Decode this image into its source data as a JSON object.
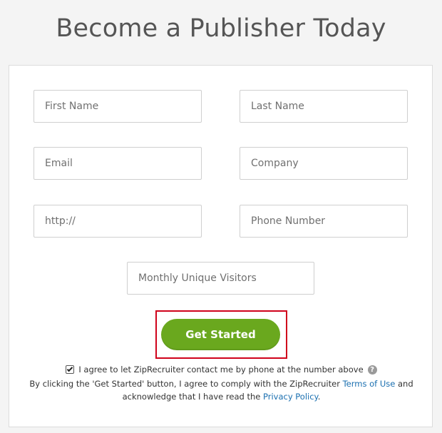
{
  "page": {
    "title": "Become a Publisher Today"
  },
  "form": {
    "first_name_placeholder": "First Name",
    "last_name_placeholder": "Last Name",
    "email_placeholder": "Email",
    "company_placeholder": "Company",
    "url_placeholder": "http://",
    "phone_placeholder": "Phone Number",
    "visitors_placeholder": "Monthly Unique Visitors",
    "submit_label": "Get Started"
  },
  "consent": {
    "checked": true,
    "checkbox_label": "I agree to let ZipRecruiter contact me by phone at the number above",
    "help_icon": "question-circle-icon",
    "terms_prefix": "By clicking the 'Get Started' button, I agree to comply with the ZipRecruiter ",
    "terms_link": "Terms of Use",
    "terms_middle": " and",
    "terms_line2_prefix": "acknowledge that I have read the ",
    "privacy_link": "Privacy Policy",
    "terms_suffix": "."
  },
  "colors": {
    "button_green": "#6aa81e",
    "highlight_red": "#d0021b",
    "link_blue": "#1a6fb0"
  }
}
